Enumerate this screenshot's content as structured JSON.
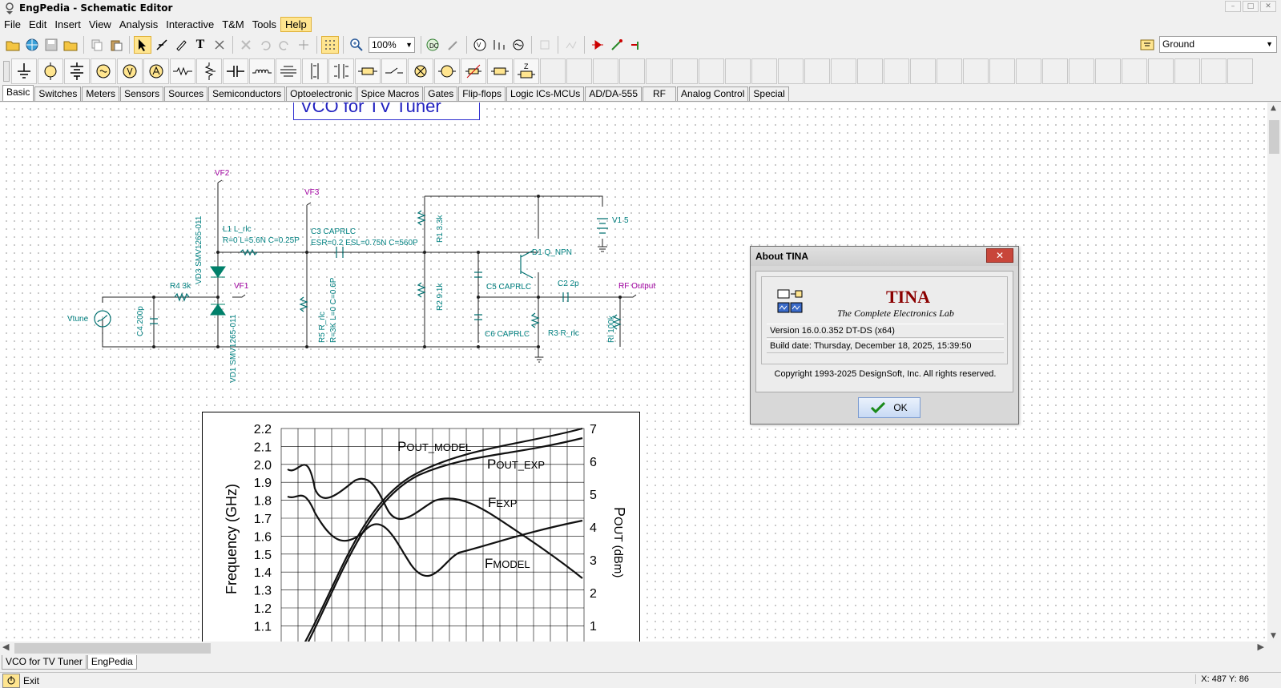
{
  "window": {
    "title": "EngPedia - Schematic Editor"
  },
  "menu": [
    "File",
    "Edit",
    "Insert",
    "View",
    "Analysis",
    "Interactive",
    "T&M",
    "Tools",
    "Help"
  ],
  "toolbar": {
    "zoom": "100%",
    "ground_select": "Ground"
  },
  "component_tabs": [
    "Basic",
    "Switches",
    "Meters",
    "Sensors",
    "Sources",
    "Semiconductors",
    "Optoelectronic",
    "Spice Macros",
    "Gates",
    "Flip-flops",
    "Logic ICs-MCUs",
    "AD/DA-555",
    "RF",
    "Analog Control",
    "Special"
  ],
  "schematic": {
    "title": "VCO for TV Tuner",
    "labels": {
      "vf2": "VF2",
      "vf3": "VF3",
      "vf1": "VF1",
      "rf_output": "RF Output",
      "vtune": "Vtune",
      "l1": "L1 L_rlc",
      "l1_params": "R=0 L=5.6N C=0.25P",
      "c3": "C3 CAPRLC",
      "c3_params": "ESR=0.2 ESL=0.75N C=560P",
      "r4": "R4 3k",
      "r1": "R1 3.3k",
      "r2": "R2 9.1k",
      "d1": "D1 Q_NPN",
      "v1": "V1 5",
      "c5": "C5 CAPRLC",
      "c6": "C6 CAPRLC",
      "c2": "C2 2p",
      "r3": "R3 R_rlc",
      "rl": "Rl 100k",
      "c4": "C4 200p",
      "vd3": "VD3 SMV1265-011",
      "vd1": "VD1 SMV1265-011",
      "r5": "R5 R_rlc",
      "r5_params": "R=3K L=0 C=0.6P"
    }
  },
  "graph": {
    "ylabel_left": "Frequency (GHz)",
    "ylabel_right_main": "P",
    "ylabel_right_sub": "OUT (dBm)",
    "left_ticks": [
      "2.2",
      "2.1",
      "2.0",
      "1.9",
      "1.8",
      "1.7",
      "1.6",
      "1.5",
      "1.4",
      "1.3",
      "1.2",
      "1.1"
    ],
    "right_ticks": [
      "7",
      "6",
      "5",
      "4",
      "3",
      "2",
      "1"
    ],
    "curve_labels": {
      "pout_model": {
        "main": "P",
        "sub": "OUT_MODEL"
      },
      "pout_exp": {
        "main": "P",
        "sub": "OUT_EXP"
      },
      "f_exp": {
        "main": "F",
        "sub": "EXP"
      },
      "f_model": {
        "main": "F",
        "sub": "MODEL"
      }
    }
  },
  "about_dialog": {
    "title": "About TINA",
    "product": "TINA",
    "tagline": "The Complete Electronics Lab",
    "version": "Version 16.0.0.352 DT-DS  (x64)",
    "build_date": "Build date: Thursday, December 18, 2025, 15:39:50",
    "copyright": "Copyright 1993-2025 DesignSoft, Inc. All rights reserved.",
    "ok_label": "OK"
  },
  "doc_tabs": [
    "VCO for TV Tuner",
    "EngPedia"
  ],
  "status": {
    "exit_label": "Exit",
    "coords": "X: 487  Y: 86"
  }
}
